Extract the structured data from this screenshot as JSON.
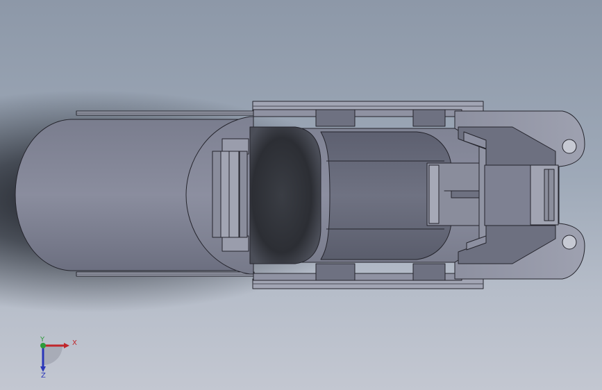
{
  "app": {
    "view": "cad-3d-viewport"
  },
  "model": {
    "description_icon": "part-section-view",
    "colors": {
      "body": "#7d8090",
      "body_light": "#9598a8",
      "body_dark": "#5b5e6c",
      "edge": "#24242c",
      "cavity": "#2f3238"
    }
  },
  "triad": {
    "x_label": "X",
    "y_label": "Y",
    "z_label": "Z",
    "colors": {
      "x": "#c0262b",
      "y": "#2e9b3a",
      "z": "#2a36b8"
    }
  }
}
